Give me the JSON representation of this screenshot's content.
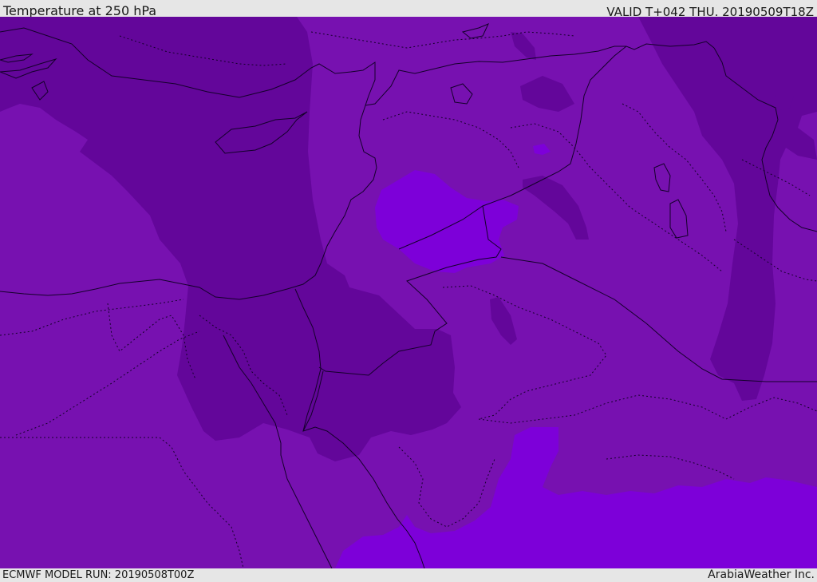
{
  "header": {
    "title": "Temperature at 250 hPa",
    "valid_time": "VALID T+042 THU. 20190509T18Z"
  },
  "footer": {
    "model_run": "ECMWF MODEL RUN: 20190508T00Z",
    "credit": "ArabiaWeather Inc."
  },
  "map": {
    "field": "Temperature at 250 hPa",
    "colors": {
      "background_band": "#7711b0",
      "cold_band": "#63069a",
      "warm_band": "#7d00d9",
      "outline": "#14002a",
      "frame": "#e6e6e6"
    }
  }
}
